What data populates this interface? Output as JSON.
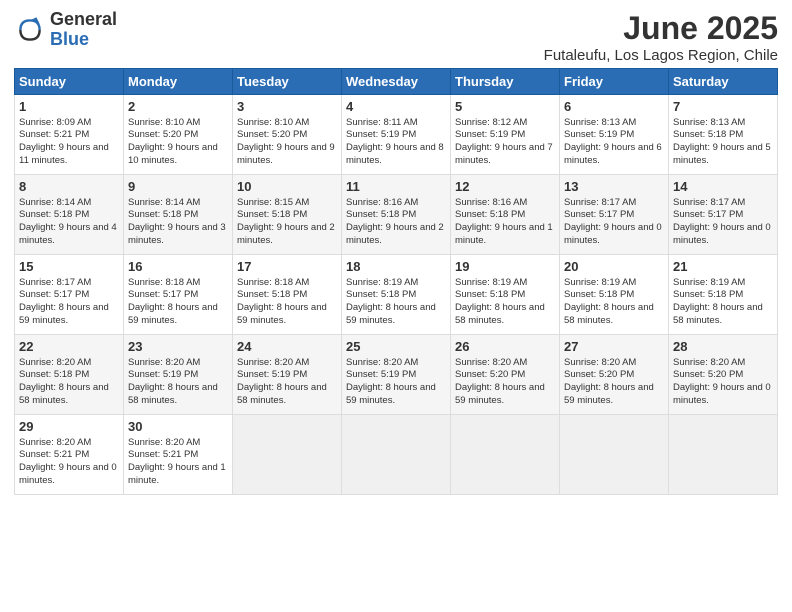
{
  "logo": {
    "general": "General",
    "blue": "Blue"
  },
  "title": "June 2025",
  "location": "Futaleufu, Los Lagos Region, Chile",
  "headers": [
    "Sunday",
    "Monday",
    "Tuesday",
    "Wednesday",
    "Thursday",
    "Friday",
    "Saturday"
  ],
  "weeks": [
    [
      {
        "day": "1",
        "sunrise": "Sunrise: 8:09 AM",
        "sunset": "Sunset: 5:21 PM",
        "daylight": "Daylight: 9 hours and 11 minutes."
      },
      {
        "day": "2",
        "sunrise": "Sunrise: 8:10 AM",
        "sunset": "Sunset: 5:20 PM",
        "daylight": "Daylight: 9 hours and 10 minutes."
      },
      {
        "day": "3",
        "sunrise": "Sunrise: 8:10 AM",
        "sunset": "Sunset: 5:20 PM",
        "daylight": "Daylight: 9 hours and 9 minutes."
      },
      {
        "day": "4",
        "sunrise": "Sunrise: 8:11 AM",
        "sunset": "Sunset: 5:19 PM",
        "daylight": "Daylight: 9 hours and 8 minutes."
      },
      {
        "day": "5",
        "sunrise": "Sunrise: 8:12 AM",
        "sunset": "Sunset: 5:19 PM",
        "daylight": "Daylight: 9 hours and 7 minutes."
      },
      {
        "day": "6",
        "sunrise": "Sunrise: 8:13 AM",
        "sunset": "Sunset: 5:19 PM",
        "daylight": "Daylight: 9 hours and 6 minutes."
      },
      {
        "day": "7",
        "sunrise": "Sunrise: 8:13 AM",
        "sunset": "Sunset: 5:18 PM",
        "daylight": "Daylight: 9 hours and 5 minutes."
      }
    ],
    [
      {
        "day": "8",
        "sunrise": "Sunrise: 8:14 AM",
        "sunset": "Sunset: 5:18 PM",
        "daylight": "Daylight: 9 hours and 4 minutes."
      },
      {
        "day": "9",
        "sunrise": "Sunrise: 8:14 AM",
        "sunset": "Sunset: 5:18 PM",
        "daylight": "Daylight: 9 hours and 3 minutes."
      },
      {
        "day": "10",
        "sunrise": "Sunrise: 8:15 AM",
        "sunset": "Sunset: 5:18 PM",
        "daylight": "Daylight: 9 hours and 2 minutes."
      },
      {
        "day": "11",
        "sunrise": "Sunrise: 8:16 AM",
        "sunset": "Sunset: 5:18 PM",
        "daylight": "Daylight: 9 hours and 2 minutes."
      },
      {
        "day": "12",
        "sunrise": "Sunrise: 8:16 AM",
        "sunset": "Sunset: 5:18 PM",
        "daylight": "Daylight: 9 hours and 1 minute."
      },
      {
        "day": "13",
        "sunrise": "Sunrise: 8:17 AM",
        "sunset": "Sunset: 5:17 PM",
        "daylight": "Daylight: 9 hours and 0 minutes."
      },
      {
        "day": "14",
        "sunrise": "Sunrise: 8:17 AM",
        "sunset": "Sunset: 5:17 PM",
        "daylight": "Daylight: 9 hours and 0 minutes."
      }
    ],
    [
      {
        "day": "15",
        "sunrise": "Sunrise: 8:17 AM",
        "sunset": "Sunset: 5:17 PM",
        "daylight": "Daylight: 8 hours and 59 minutes."
      },
      {
        "day": "16",
        "sunrise": "Sunrise: 8:18 AM",
        "sunset": "Sunset: 5:17 PM",
        "daylight": "Daylight: 8 hours and 59 minutes."
      },
      {
        "day": "17",
        "sunrise": "Sunrise: 8:18 AM",
        "sunset": "Sunset: 5:18 PM",
        "daylight": "Daylight: 8 hours and 59 minutes."
      },
      {
        "day": "18",
        "sunrise": "Sunrise: 8:19 AM",
        "sunset": "Sunset: 5:18 PM",
        "daylight": "Daylight: 8 hours and 59 minutes."
      },
      {
        "day": "19",
        "sunrise": "Sunrise: 8:19 AM",
        "sunset": "Sunset: 5:18 PM",
        "daylight": "Daylight: 8 hours and 58 minutes."
      },
      {
        "day": "20",
        "sunrise": "Sunrise: 8:19 AM",
        "sunset": "Sunset: 5:18 PM",
        "daylight": "Daylight: 8 hours and 58 minutes."
      },
      {
        "day": "21",
        "sunrise": "Sunrise: 8:19 AM",
        "sunset": "Sunset: 5:18 PM",
        "daylight": "Daylight: 8 hours and 58 minutes."
      }
    ],
    [
      {
        "day": "22",
        "sunrise": "Sunrise: 8:20 AM",
        "sunset": "Sunset: 5:18 PM",
        "daylight": "Daylight: 8 hours and 58 minutes."
      },
      {
        "day": "23",
        "sunrise": "Sunrise: 8:20 AM",
        "sunset": "Sunset: 5:19 PM",
        "daylight": "Daylight: 8 hours and 58 minutes."
      },
      {
        "day": "24",
        "sunrise": "Sunrise: 8:20 AM",
        "sunset": "Sunset: 5:19 PM",
        "daylight": "Daylight: 8 hours and 58 minutes."
      },
      {
        "day": "25",
        "sunrise": "Sunrise: 8:20 AM",
        "sunset": "Sunset: 5:19 PM",
        "daylight": "Daylight: 8 hours and 59 minutes."
      },
      {
        "day": "26",
        "sunrise": "Sunrise: 8:20 AM",
        "sunset": "Sunset: 5:20 PM",
        "daylight": "Daylight: 8 hours and 59 minutes."
      },
      {
        "day": "27",
        "sunrise": "Sunrise: 8:20 AM",
        "sunset": "Sunset: 5:20 PM",
        "daylight": "Daylight: 8 hours and 59 minutes."
      },
      {
        "day": "28",
        "sunrise": "Sunrise: 8:20 AM",
        "sunset": "Sunset: 5:20 PM",
        "daylight": "Daylight: 9 hours and 0 minutes."
      }
    ],
    [
      {
        "day": "29",
        "sunrise": "Sunrise: 8:20 AM",
        "sunset": "Sunset: 5:21 PM",
        "daylight": "Daylight: 9 hours and 0 minutes."
      },
      {
        "day": "30",
        "sunrise": "Sunrise: 8:20 AM",
        "sunset": "Sunset: 5:21 PM",
        "daylight": "Daylight: 9 hours and 1 minute."
      },
      null,
      null,
      null,
      null,
      null
    ]
  ]
}
